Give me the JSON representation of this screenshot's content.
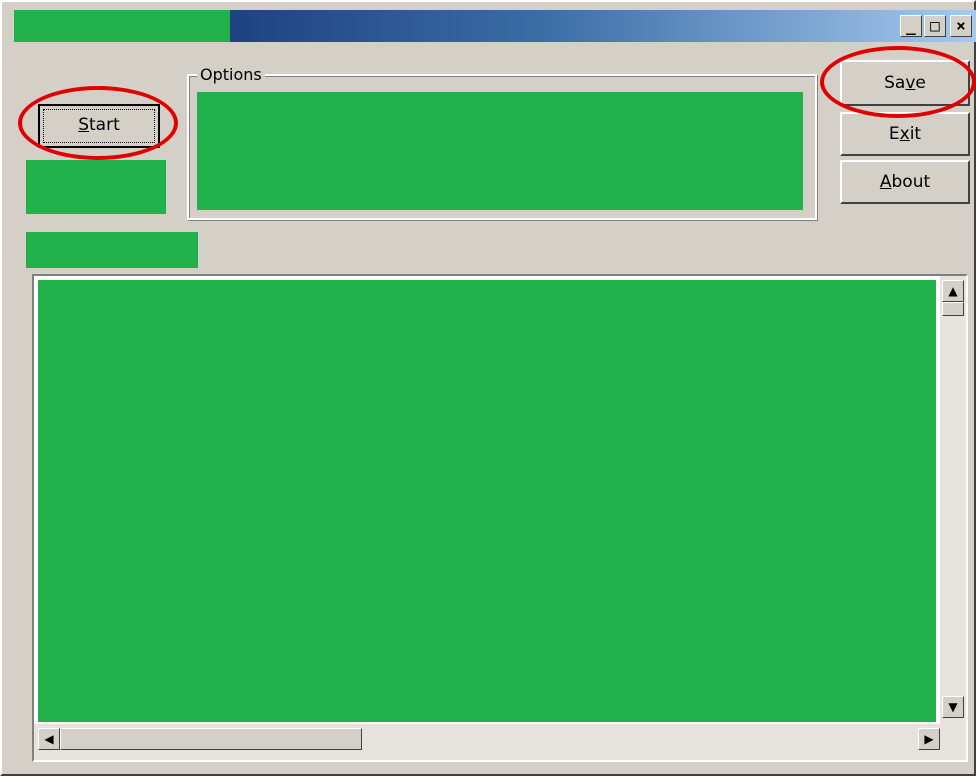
{
  "window": {
    "caption_buttons": {
      "minimize": "_",
      "maximize": "□",
      "close": "×"
    }
  },
  "actions": {
    "start": {
      "label_underlined": "S",
      "label_rest": "tart"
    },
    "save": {
      "label_before": "Sa",
      "label_underlined": "v",
      "label_after": "e"
    },
    "exit": {
      "label_before": "E",
      "label_underlined": "x",
      "label_after": "it"
    },
    "about": {
      "label_underlined": "A",
      "label_after": "bout"
    }
  },
  "options_group": {
    "label": "Options"
  },
  "scrollbar": {
    "up_arrow": "▲",
    "down_arrow": "▼",
    "left_arrow": "◀",
    "right_arrow": "▶"
  },
  "colors": {
    "redaction_green": "#22b04b",
    "window_face": "#d4d0c8",
    "annotation_red": "#e00000"
  },
  "annotations": [
    "start-button",
    "save-button"
  ]
}
